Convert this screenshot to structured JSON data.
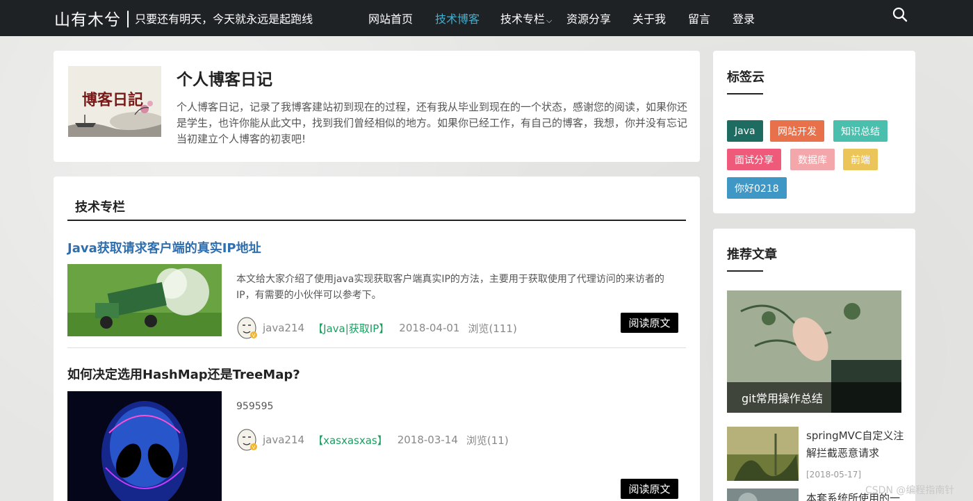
{
  "header": {
    "site_name": "山有木兮",
    "separator": "|",
    "motto": "只要还有明天，今天就永远是起跑线",
    "nav": [
      {
        "label": "网站首页",
        "active": false
      },
      {
        "label": "技术博客",
        "active": true
      },
      {
        "label": "技术专栏",
        "active": false,
        "has_dropdown": true
      },
      {
        "label": "资源分享",
        "active": false
      },
      {
        "label": "关于我",
        "active": false
      },
      {
        "label": "留言",
        "active": false
      },
      {
        "label": "登录",
        "active": false
      }
    ],
    "search_icon": "search-icon"
  },
  "intro": {
    "image_text": "博客日記",
    "title": "个人博客日记",
    "text": "个人博客日记，记录了我博客建站初到现在的过程，还有我从毕业到现在的一个状态，感谢您的阅读，如果你还是学生，也许你能从此文中，找到我们曾经相似的地方。如果你已经工作，有自己的博客，我想，你并没有忘记当初建立个人博客的初衷吧!"
  },
  "column": {
    "title": "技术专栏",
    "posts": [
      {
        "title": "Java获取请求客户端的真实IP地址",
        "summary": "本文给大家介绍了使用java实现获取客户端真实IP的方法，主要用于获取使用了代理访问的来访者的IP，有需要的小伙伴可以参考下。",
        "author": "java214",
        "tag": "【Java|获取IP】",
        "date": "2018-04-01",
        "views": "浏览(111)",
        "read_label": "阅读原文"
      },
      {
        "title": "如何决定选用HashMap还是TreeMap?",
        "summary": "959595",
        "author": "java214",
        "tag": "【xasxasxas】",
        "date": "2018-03-14",
        "views": "浏览(11)",
        "read_label": "阅读原文"
      }
    ]
  },
  "tag_cloud": {
    "title": "标签云",
    "tags": [
      {
        "label": "Java",
        "color": "#1e6b62"
      },
      {
        "label": "网站开发",
        "color": "#e8704a"
      },
      {
        "label": "知识总结",
        "color": "#4bbfae"
      },
      {
        "label": "面试分享",
        "color": "#f05a7a"
      },
      {
        "label": "数据库",
        "color": "#f4a7ab"
      },
      {
        "label": "前端",
        "color": "#ecc55a"
      },
      {
        "label": "你好0218",
        "color": "#3e97c4"
      }
    ]
  },
  "recommended": {
    "title": "推荐文章",
    "hero_caption": "git常用操作总结",
    "items": [
      {
        "title": "springMVC自定义注解拦截恶意请求",
        "date": "[2018-05-17]"
      },
      {
        "title": "本套系统所使用的一",
        "date": ""
      }
    ]
  },
  "watermark": "CSDN @编程指南针"
}
